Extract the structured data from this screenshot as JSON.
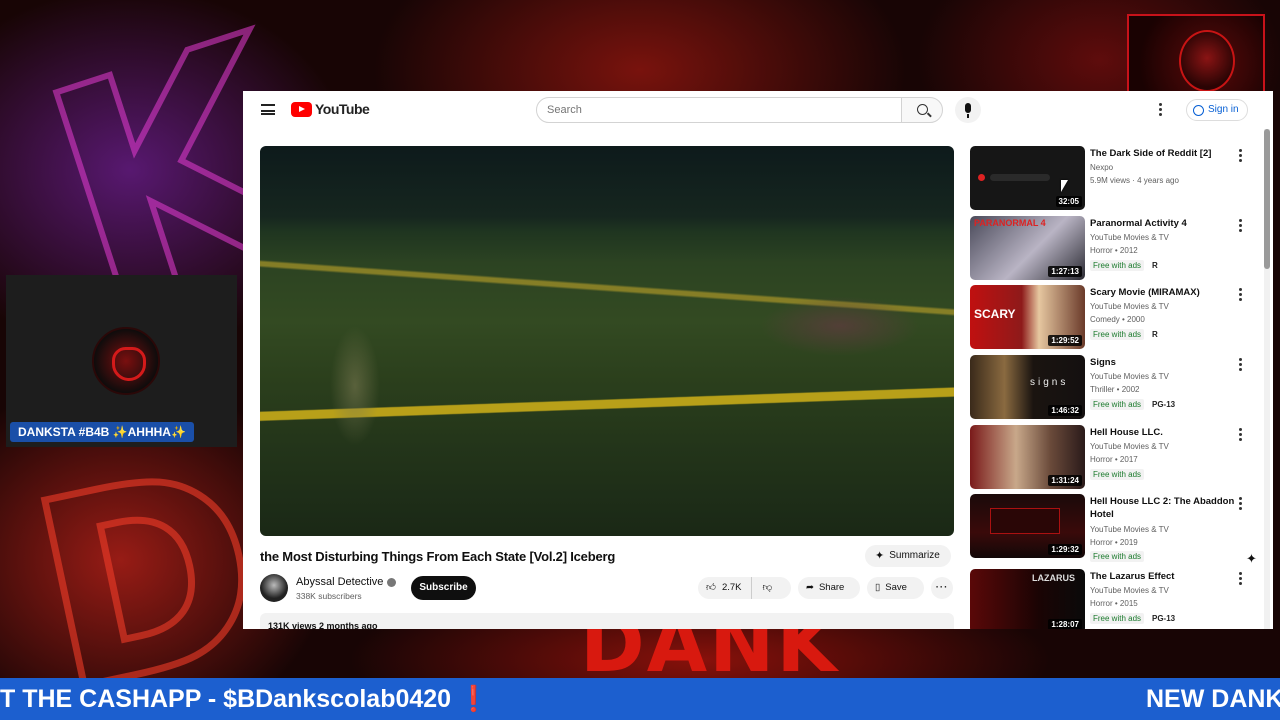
{
  "overlay": {
    "webcam_name": "DANKSTA #B4B ✨AHHHA✨",
    "ticker_left": "T THE CASHAPP - $BDankscolab0420 ❗",
    "ticker_right": "NEW DANK",
    "bg_text_bottom": "DANK",
    "logo_text": "DANK"
  },
  "youtube": {
    "logo": "YouTube",
    "search_placeholder": "Search",
    "sign_in": "Sign in",
    "video": {
      "title": "the Most Disturbing Things From Each State [Vol.2] Iceberg",
      "summarize": "Summarize",
      "channel": "Abyssal Detective",
      "subscribers": "338K subscribers",
      "subscribe": "Subscribe",
      "likes": "2.7K",
      "share": "Share",
      "save": "Save",
      "meta": "131K views  2 months ago"
    },
    "recommendations": [
      {
        "title": "The Dark Side of Reddit [2]",
        "channel": "Nexpo",
        "meta": "5.9M views · 4 years ago",
        "duration": "32:05",
        "free": "",
        "rating": ""
      },
      {
        "title": "Paranormal Activity 4",
        "channel": "YouTube Movies & TV",
        "meta": "Horror • 2012",
        "duration": "1:27:13",
        "free": "Free with ads",
        "rating": "R"
      },
      {
        "title": "Scary Movie (MIRAMAX)",
        "channel": "YouTube Movies & TV",
        "meta": "Comedy • 2000",
        "duration": "1:29:52",
        "free": "Free with ads",
        "rating": "R"
      },
      {
        "title": "Signs",
        "channel": "YouTube Movies & TV",
        "meta": "Thriller • 2002",
        "duration": "1:46:32",
        "free": "Free with ads",
        "rating": "PG-13"
      },
      {
        "title": "Hell House LLC.",
        "channel": "YouTube Movies & TV",
        "meta": "Horror • 2017",
        "duration": "1:31:24",
        "free": "Free with ads",
        "rating": ""
      },
      {
        "title": "Hell House LLC 2: The Abaddon Hotel",
        "channel": "YouTube Movies & TV",
        "meta": "Horror • 2019",
        "duration": "1:29:32",
        "free": "Free with ads",
        "rating": ""
      },
      {
        "title": "The Lazarus Effect",
        "channel": "YouTube Movies & TV",
        "meta": "Horror • 2015",
        "duration": "1:28:07",
        "free": "Free with ads",
        "rating": "PG-13"
      }
    ]
  }
}
